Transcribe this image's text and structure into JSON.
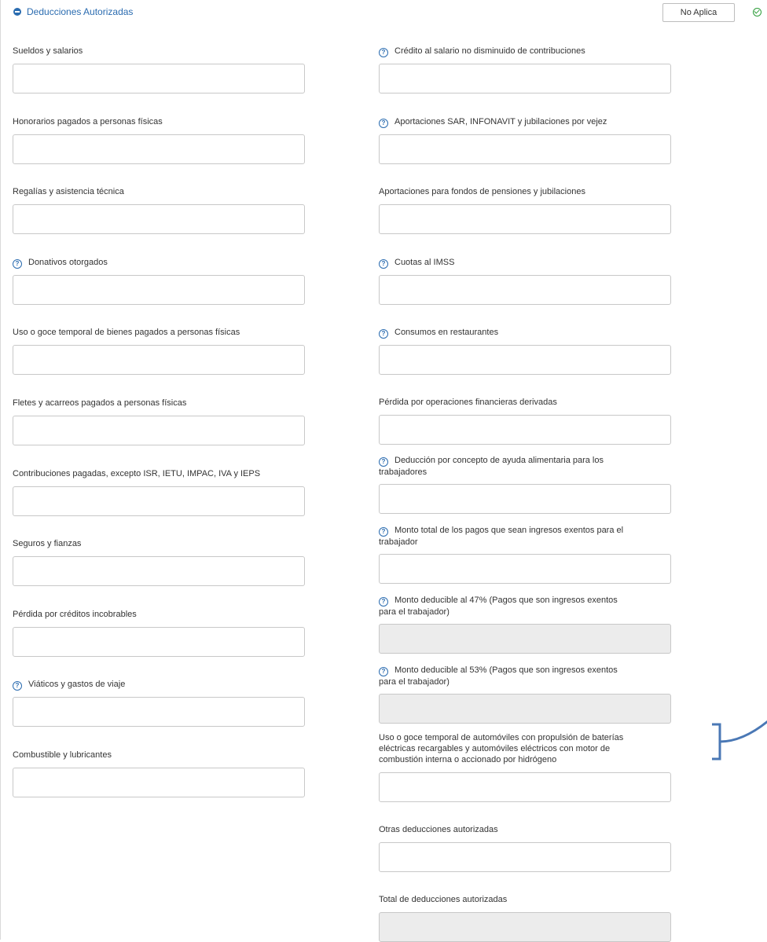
{
  "header": {
    "title": "Deducciones Autorizadas",
    "not_applicable_label": "No Aplica"
  },
  "left_fields": [
    {
      "label": "Sueldos y salarios",
      "value": "",
      "help": false
    },
    {
      "label": "Honorarios pagados a personas físicas",
      "value": "",
      "help": false
    },
    {
      "label": "Regalías y asistencia técnica",
      "value": "",
      "help": false
    },
    {
      "label": "Donativos otorgados",
      "value": "",
      "help": true
    },
    {
      "label": "Uso o goce temporal de bienes pagados a personas físicas",
      "value": "",
      "help": false
    },
    {
      "label": "Fletes y acarreos pagados a personas físicas",
      "value": "",
      "help": false
    },
    {
      "label": "Contribuciones pagadas, excepto ISR, IETU, IMPAC, IVA y IEPS",
      "value": "",
      "help": false
    },
    {
      "label": "Seguros y fianzas",
      "value": "",
      "help": false
    },
    {
      "label": "Pérdida por créditos incobrables",
      "value": "",
      "help": false
    },
    {
      "label": "Viáticos y gastos de viaje",
      "value": "",
      "help": true
    },
    {
      "label": "Combustible y lubricantes",
      "value": "",
      "help": false
    }
  ],
  "right_fields": [
    {
      "label_lines": [
        "Crédito al salario no disminuido de contribuciones"
      ],
      "value": "",
      "help": true,
      "readonly": false
    },
    {
      "label_lines": [
        "Aportaciones SAR, INFONAVIT y jubilaciones por vejez"
      ],
      "value": "",
      "help": true,
      "readonly": false
    },
    {
      "label_lines": [
        "Aportaciones para fondos de pensiones y jubilaciones"
      ],
      "value": "",
      "help": false,
      "readonly": false
    },
    {
      "label_lines": [
        "Cuotas al IMSS"
      ],
      "value": "",
      "help": true,
      "readonly": false
    },
    {
      "label_lines": [
        "Consumos en restaurantes"
      ],
      "value": "",
      "help": true,
      "readonly": false
    },
    {
      "label_lines": [
        "Pérdida por operaciones financieras derivadas"
      ],
      "value": "",
      "help": false,
      "readonly": false
    },
    {
      "label_lines": [
        "Deducción por concepto de ayuda alimentaria para los",
        "trabajadores"
      ],
      "value": "",
      "help": true,
      "readonly": false
    },
    {
      "label_lines": [
        "Monto total de los pagos que sean ingresos exentos para el",
        "trabajador"
      ],
      "value": "",
      "help": true,
      "readonly": false
    },
    {
      "label_lines": [
        "Monto deducible al 47% (Pagos que son ingresos exentos",
        "para el trabajador)"
      ],
      "value": "",
      "help": true,
      "readonly": true
    },
    {
      "label_lines": [
        "Monto deducible al 53% (Pagos que son ingresos exentos",
        "para el trabajador)"
      ],
      "value": "",
      "help": true,
      "readonly": true
    },
    {
      "label_lines": [
        "Uso o goce temporal de automóviles con propulsión de baterías",
        "eléctricas recargables y automóviles eléctricos con motor de",
        "combustión interna o accionado por hidrógeno"
      ],
      "value": "",
      "help": false,
      "readonly": false
    },
    {
      "label_lines": [
        "Otras deducciones autorizadas"
      ],
      "value": "",
      "help": false,
      "readonly": false
    },
    {
      "label_lines": [
        "Total de deducciones autorizadas"
      ],
      "value": "",
      "help": false,
      "readonly": true
    }
  ],
  "colors": {
    "accent": "#2b6cb0",
    "success": "#2e9d3a",
    "annotation": "#4a78b5",
    "readonly_bg": "#ececec"
  }
}
